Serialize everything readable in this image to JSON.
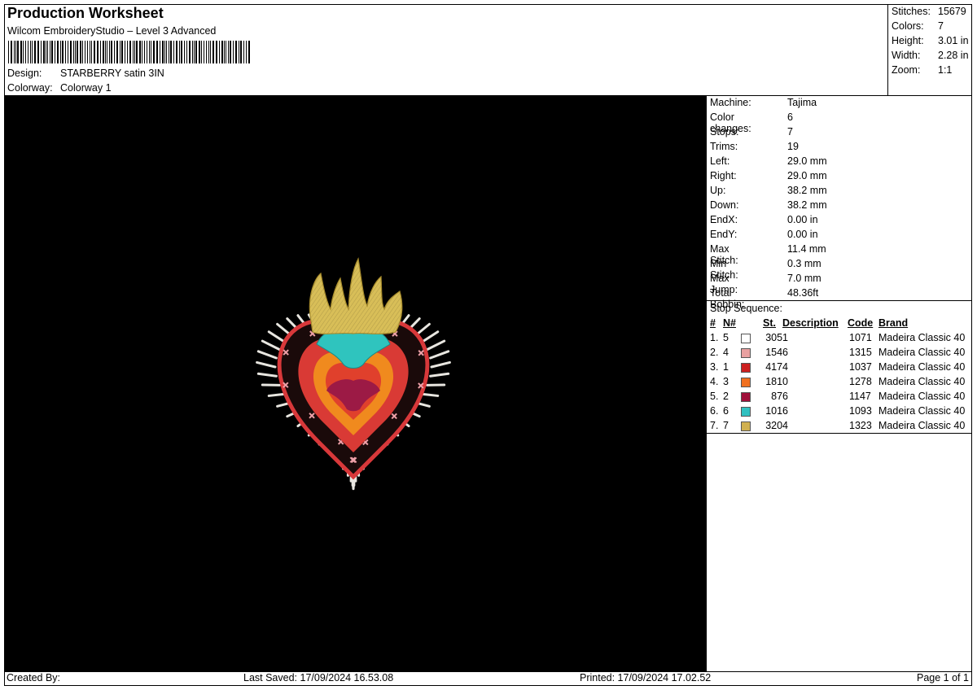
{
  "header": {
    "title": "Production Worksheet",
    "software": "Wilcom EmbroideryStudio – Level 3 Advanced",
    "design_label": "Design:",
    "design_value": "STARBERRY satin 3IN",
    "colorway_label": "Colorway:",
    "colorway_value": "Colorway 1"
  },
  "summary": [
    {
      "label": "Stitches:",
      "value": "15679"
    },
    {
      "label": "Colors:",
      "value": "7"
    },
    {
      "label": "Height:",
      "value": "3.01 in"
    },
    {
      "label": "Width:",
      "value": "2.28 in"
    },
    {
      "label": "Zoom:",
      "value": "1:1"
    }
  ],
  "machine_info": [
    {
      "label": "Machine:",
      "value": "Tajima"
    },
    {
      "label": "Color changes:",
      "value": "6"
    },
    {
      "label": "Stops:",
      "value": "7"
    },
    {
      "label": "Trims:",
      "value": "19"
    },
    {
      "label": "Left:",
      "value": "29.0 mm"
    },
    {
      "label": "Right:",
      "value": "29.0 mm"
    },
    {
      "label": "Up:",
      "value": "38.2 mm"
    },
    {
      "label": "Down:",
      "value": "38.2 mm"
    },
    {
      "label": "EndX:",
      "value": "0.00 in"
    },
    {
      "label": "EndY:",
      "value": "0.00 in"
    },
    {
      "label": "Max Stitch:",
      "value": "11.4 mm"
    },
    {
      "label": "Min Stitch:",
      "value": "0.3 mm"
    },
    {
      "label": "Max Jump:",
      "value": "7.0 mm"
    },
    {
      "label": "Total Bobbin:",
      "value": "48.36ft"
    }
  ],
  "stop_sequence": {
    "title": "Stop Sequence:",
    "columns": [
      "#",
      "N#",
      "St.",
      "Description",
      "Code",
      "Brand"
    ],
    "rows": [
      {
        "num": "1.",
        "n": "5",
        "color": "#ffffff",
        "st": "3051",
        "code": "1071",
        "brand": "Madeira Classic 40"
      },
      {
        "num": "2.",
        "n": "4",
        "color": "#e8a0a0",
        "st": "1546",
        "code": "1315",
        "brand": "Madeira Classic 40"
      },
      {
        "num": "3.",
        "n": "1",
        "color": "#cc1f1f",
        "st": "4174",
        "code": "1037",
        "brand": "Madeira Classic 40"
      },
      {
        "num": "4.",
        "n": "3",
        "color": "#f07020",
        "st": "1810",
        "code": "1278",
        "brand": "Madeira Classic 40"
      },
      {
        "num": "5.",
        "n": "2",
        "color": "#a0103a",
        "st": "876",
        "code": "1147",
        "brand": "Madeira Classic 40"
      },
      {
        "num": "6.",
        "n": "6",
        "color": "#30c0c0",
        "st": "1016",
        "code": "1093",
        "brand": "Madeira Classic 40"
      },
      {
        "num": "7.",
        "n": "7",
        "color": "#d0b050",
        "st": "3204",
        "code": "1323",
        "brand": "Madeira Classic 40"
      }
    ]
  },
  "footer": {
    "created_by": "Created By:",
    "last_saved": "Last Saved: 17/09/2024 16.53.08",
    "printed": "Printed: 17/09/2024 17.02.52",
    "page": "Page 1 of 1"
  }
}
